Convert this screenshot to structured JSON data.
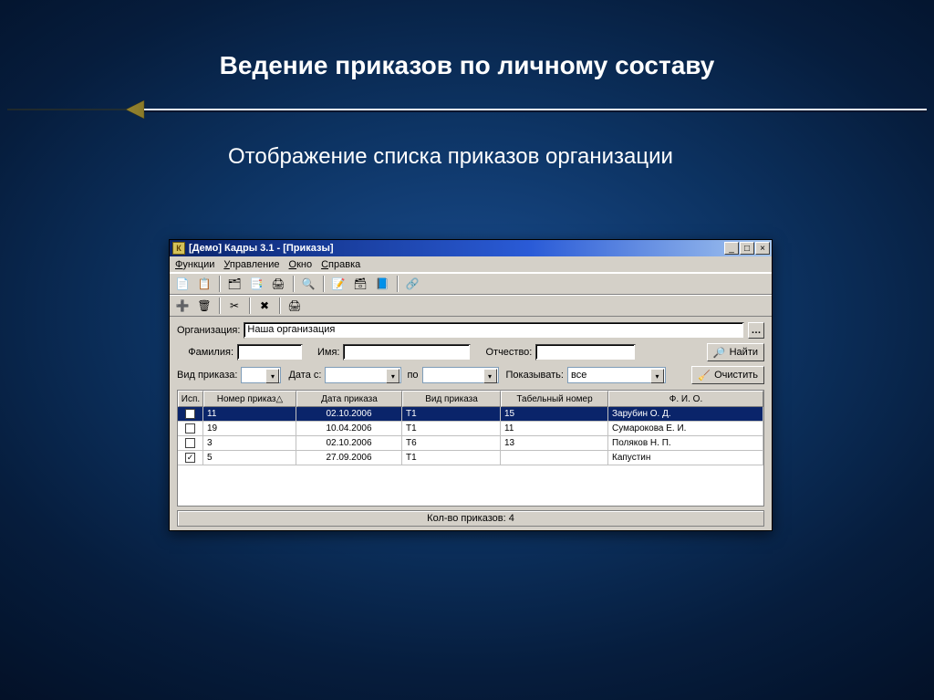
{
  "slide": {
    "title": "Ведение приказов по личному составу",
    "subtitle": "Отображение списка приказов организации"
  },
  "window": {
    "title": "[Демо] Кадры 3.1 - [Приказы]",
    "controls": {
      "min": "_",
      "max": "□",
      "close": "×"
    },
    "menus": {
      "m1u": "Ф",
      "m1": "ункции",
      "m2u": "У",
      "m2": "правление",
      "m3u": "О",
      "m3": "кно",
      "m4u": "С",
      "m4": "правка"
    }
  },
  "form": {
    "org_label": "Организация:",
    "org_value": "Наша организация",
    "fam_label": "Фамилия:",
    "name_label": "Имя:",
    "otch_label": "Отчество:",
    "find_label": "Найти",
    "type_label": "Вид приказа:",
    "datefrom_label": "Дата с:",
    "dateto_label": "по",
    "show_label": "Показывать:",
    "show_value": "все",
    "clear_label": "Очистить"
  },
  "grid": {
    "cols": {
      "isp": "Исп.",
      "num": "Номер приказ△",
      "date": "Дата приказа",
      "vid": "Вид приказа",
      "tab": "Табельный номер",
      "fio": "Ф. И. О."
    },
    "rows": [
      {
        "chk": false,
        "sel": true,
        "num": "11",
        "date": "02.10.2006",
        "vid": "T1",
        "tab": "15",
        "fio": "Зарубин О. Д."
      },
      {
        "chk": false,
        "sel": false,
        "num": "19",
        "date": "10.04.2006",
        "vid": "T1",
        "tab": "11",
        "fio": "Сумарокова Е. И."
      },
      {
        "chk": false,
        "sel": false,
        "num": "3",
        "date": "02.10.2006",
        "vid": "T6",
        "tab": "13",
        "fio": "Поляков Н. П."
      },
      {
        "chk": true,
        "sel": false,
        "num": "5",
        "date": "27.09.2006",
        "vid": "T1",
        "tab": "",
        "fio": "Капустин"
      }
    ]
  },
  "status": {
    "count_label": "Кол-во приказов: 4"
  },
  "icons": {
    "doc": "📄",
    "list": "📋",
    "card": "🗂",
    "copy": "📑",
    "print": "🖨",
    "search": "🔍",
    "edit": "📝",
    "box": "🗃",
    "book": "📘",
    "link": "🔗",
    "add": "➕",
    "del": "🗑",
    "sc": "✂",
    "x": "✖",
    "pr2": "🖨",
    "brush": "🧹",
    "bino": "🔎"
  }
}
